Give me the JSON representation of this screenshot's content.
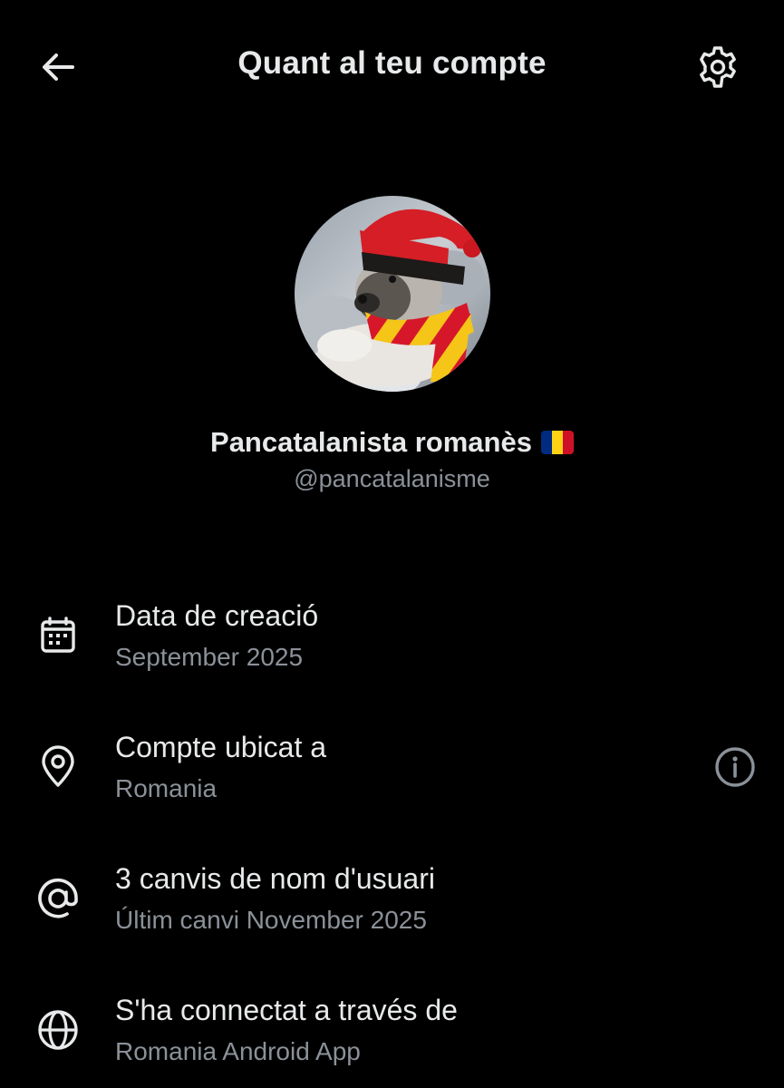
{
  "header": {
    "title": "Quant al teu compte",
    "back_icon": "arrow-left-icon",
    "settings_icon": "gear-icon"
  },
  "profile": {
    "display_name": "Pancatalanista romanès",
    "flag_emoji": "🇷🇴",
    "flag_colors": [
      "#002b7f",
      "#fcd116",
      "#ce1126"
    ],
    "handle": "@pancatalanisme",
    "avatar_description_icon": "avatar-photo"
  },
  "details": [
    {
      "icon": "calendar-icon",
      "title": "Data de creació",
      "subtitle": "September 2025"
    },
    {
      "icon": "location-pin-icon",
      "title": "Compte ubicat a",
      "subtitle": "Romania",
      "action_icon": "info-icon"
    },
    {
      "icon": "at-sign-icon",
      "title": "3 canvis de nom d'usuari",
      "subtitle": "Últim canvi November 2025"
    },
    {
      "icon": "globe-icon",
      "title": "S'ha connectat a través de",
      "subtitle": "Romania Android App"
    }
  ],
  "colors": {
    "background": "#000000",
    "primary_text": "#e7e9ea",
    "secondary_text": "#8b9198"
  }
}
